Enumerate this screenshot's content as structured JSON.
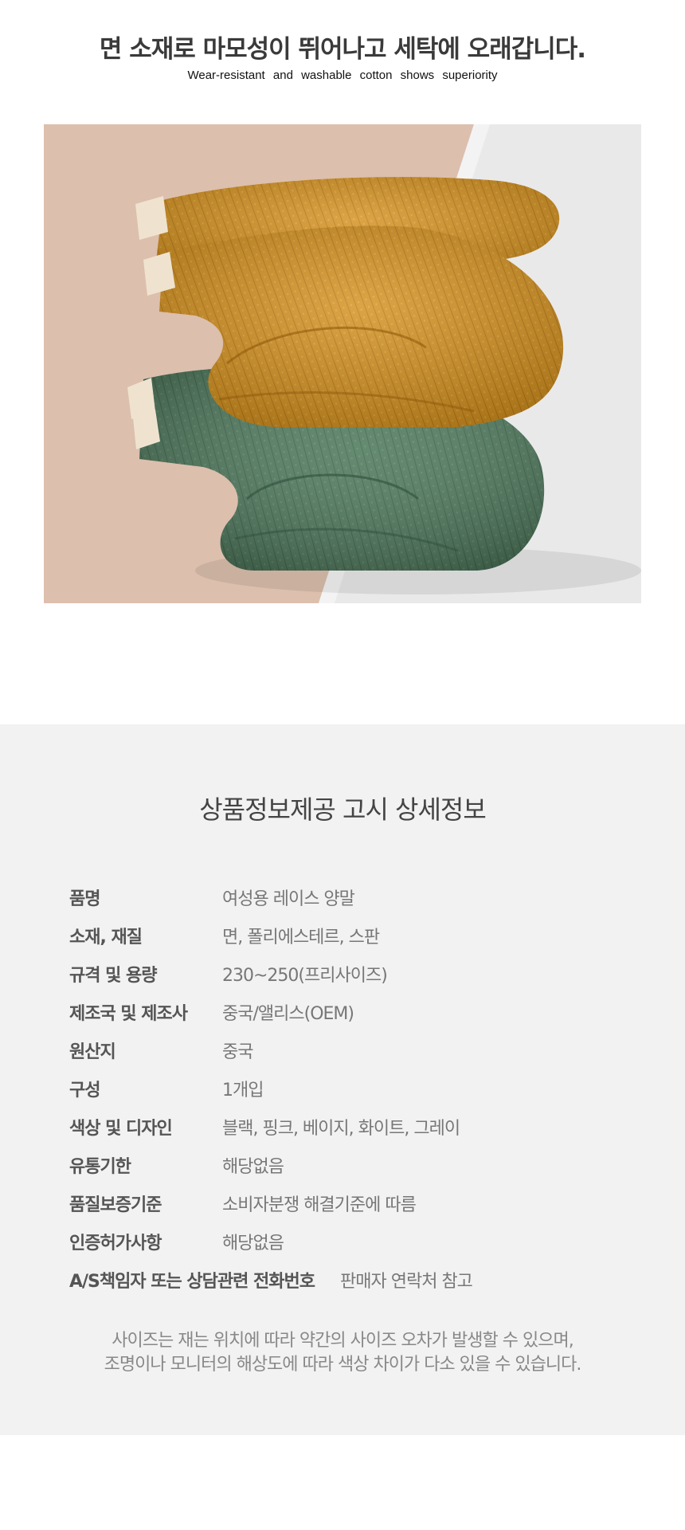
{
  "hero": {
    "title": "면 소재로 마모성이 뛰어나고 세탁에 오래갑니다.",
    "subtitle": "Wear-resistant and washable cotton shows superiority"
  },
  "colors": {
    "mustard": "#d4901c",
    "green": "#4f7a5d",
    "section_bg": "#f2f2f2",
    "backdrop_pink": "#dcbfad",
    "backdrop_gray": "#e9e9ea"
  },
  "product_info": {
    "title": "상품정보제공 고시 상세정보",
    "rows": [
      {
        "label": "품명",
        "value": "여성용 레이스 양말"
      },
      {
        "label": "소재, 재질",
        "value": "면, 폴리에스테르, 스판"
      },
      {
        "label": "규격 및 용량",
        "value": "230~250(프리사이즈)"
      },
      {
        "label": "제조국 및 제조사",
        "value": "중국/앨리스(OEM)"
      },
      {
        "label": "원산지",
        "value": "중국"
      },
      {
        "label": "구성",
        "value": "1개입"
      },
      {
        "label": "색상 및 디자인",
        "value": "블랙, 핑크, 베이지, 화이트, 그레이"
      },
      {
        "label": "유통기한",
        "value": "해당없음"
      },
      {
        "label": "품질보증기준",
        "value": "소비자분쟁 해결기준에 따름"
      },
      {
        "label": "인증허가사항",
        "value": "해당없음"
      },
      {
        "label": "A/S책임자 또는 상담관련 전화번호",
        "value": "판매자 연락처 참고"
      }
    ],
    "notice": [
      "사이즈는 재는 위치에 따라 약간의 사이즈 오차가 발생할 수 있으며,",
      "조명이나 모니터의 해상도에 따라 색상 차이가 다소 있을 수 있습니다."
    ]
  }
}
